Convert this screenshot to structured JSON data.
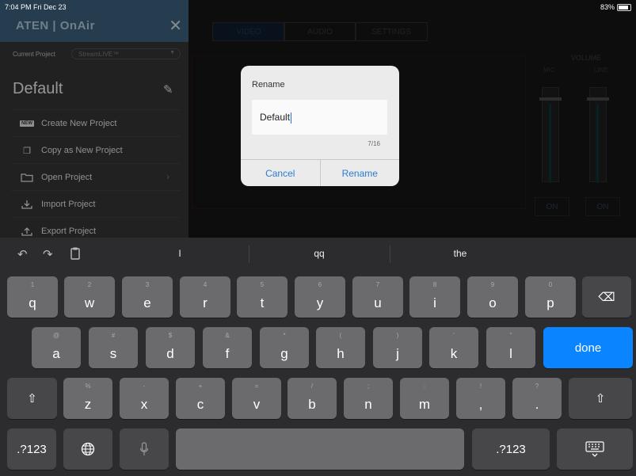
{
  "status_bar": {
    "time": "7:04 PM  Fri Dec 23",
    "battery": "83%"
  },
  "app": {
    "tabs": [
      "VIDEO",
      "AUDIO",
      "SETTINGS"
    ],
    "volume": {
      "title": "VOLUME",
      "mic_label": "MIC",
      "line_label": "LINE",
      "on_labels": [
        "ON",
        "ON"
      ]
    }
  },
  "sidebar": {
    "brand": "ATEN | OnAir",
    "close_icon": "close-icon",
    "current_project_label": "Current Project",
    "current_project_value": "StreamLIVE™",
    "project_name": "Default",
    "menu": [
      {
        "label": "Create New Project",
        "icon": "new-icon",
        "badge": "NEW"
      },
      {
        "label": "Copy as New Project",
        "icon": "copy-icon"
      },
      {
        "label": "Open Project",
        "icon": "folder-icon",
        "has_arrow": true
      },
      {
        "label": "Import Project",
        "icon": "import-icon"
      },
      {
        "label": "Export Project",
        "icon": "export-icon"
      }
    ]
  },
  "dialog": {
    "title": "Rename",
    "input_value": "Default",
    "char_count": "7/16",
    "cancel_label": "Cancel",
    "confirm_label": "Rename"
  },
  "keyboard": {
    "suggestions": [
      "I",
      "qq",
      "the"
    ],
    "row1": [
      {
        "hint": "1",
        "key": "q"
      },
      {
        "hint": "2",
        "key": "w"
      },
      {
        "hint": "3",
        "key": "e"
      },
      {
        "hint": "4",
        "key": "r"
      },
      {
        "hint": "5",
        "key": "t"
      },
      {
        "hint": "6",
        "key": "y"
      },
      {
        "hint": "7",
        "key": "u"
      },
      {
        "hint": "8",
        "key": "i"
      },
      {
        "hint": "9",
        "key": "o"
      },
      {
        "hint": "0",
        "key": "p"
      }
    ],
    "row2": [
      {
        "hint": "@",
        "key": "a"
      },
      {
        "hint": "#",
        "key": "s"
      },
      {
        "hint": "$",
        "key": "d"
      },
      {
        "hint": "&",
        "key": "f"
      },
      {
        "hint": "*",
        "key": "g"
      },
      {
        "hint": "(",
        "key": "h"
      },
      {
        "hint": ")",
        "key": "j"
      },
      {
        "hint": "'",
        "key": "k"
      },
      {
        "hint": "\"",
        "key": "l"
      }
    ],
    "row3": [
      {
        "hint": "%",
        "key": "z"
      },
      {
        "hint": "-",
        "key": "x"
      },
      {
        "hint": "+",
        "key": "c"
      },
      {
        "hint": "=",
        "key": "v"
      },
      {
        "hint": "/",
        "key": "b"
      },
      {
        "hint": ";",
        "key": "n"
      },
      {
        "hint": ":",
        "key": "m"
      },
      {
        "hint": "!",
        "key": ","
      },
      {
        "hint": "?",
        "key": "."
      }
    ],
    "done_label": "done",
    "numbers_label": ".?123",
    "backspace_icon": "backspace-icon",
    "shift_icon": "shift-icon",
    "globe_icon": "globe-icon",
    "mic_icon": "microphone-icon",
    "dismiss_icon": "keyboard-dismiss-icon"
  }
}
